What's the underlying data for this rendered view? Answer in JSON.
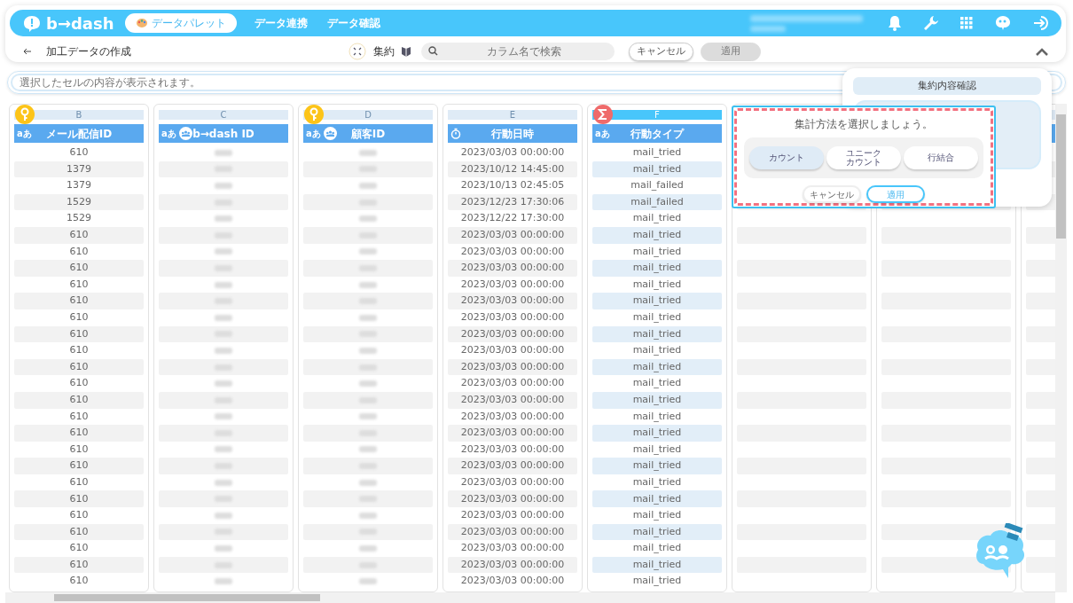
{
  "header": {
    "logo": "b→dash",
    "palette_button": "データパレット",
    "nav": [
      {
        "label": "データ連携"
      },
      {
        "label": "データ確認"
      }
    ]
  },
  "toolbar": {
    "title": "加工データの作成",
    "mode": "集約",
    "search": {
      "placeholder": "カラム名で検索"
    },
    "buttons": [
      {
        "label": "キャンセル",
        "disabled": false
      },
      {
        "label": "適用",
        "disabled": true
      }
    ]
  },
  "cell_viewer": {
    "placeholder": "選択したセルの内容が表示されます。"
  },
  "columns": [
    {
      "letter": "B",
      "name": "メール配信ID",
      "kind": "text",
      "type_label": "aあ",
      "key": true,
      "aggregated": false,
      "selected": false,
      "masked": false,
      "values": [
        "610",
        "1379",
        "1379",
        "1529",
        "1529",
        "610",
        "610",
        "610",
        "610",
        "610",
        "610",
        "610",
        "610",
        "610",
        "610",
        "610",
        "610",
        "610",
        "610",
        "610",
        "610",
        "610",
        "610",
        "610",
        "610",
        "610",
        "610"
      ]
    },
    {
      "letter": "C",
      "name": "b→dash ID",
      "kind": "user",
      "type_label": "aあ",
      "key": false,
      "aggregated": false,
      "selected": false,
      "masked": true
    },
    {
      "letter": "D",
      "name": "顧客ID",
      "kind": "user",
      "type_label": "aあ",
      "key": true,
      "aggregated": false,
      "selected": false,
      "masked": true
    },
    {
      "letter": "E",
      "name": "行動日時",
      "kind": "datetime",
      "key": false,
      "aggregated": false,
      "selected": false,
      "masked": false,
      "values": [
        "2023/03/03 00:00:00",
        "2023/10/12 14:45:00",
        "2023/10/13 02:45:05",
        "2023/12/23 17:30:06",
        "2023/12/22 17:30:00",
        "2023/03/03 00:00:00",
        "2023/03/03 00:00:00",
        "2023/03/03 00:00:00",
        "2023/03/03 00:00:00",
        "2023/03/03 00:00:00",
        "2023/03/03 00:00:00",
        "2023/03/03 00:00:00",
        "2023/03/03 00:00:00",
        "2023/03/03 00:00:00",
        "2023/03/03 00:00:00",
        "2023/03/03 00:00:00",
        "2023/03/03 00:00:00",
        "2023/03/03 00:00:00",
        "2023/03/03 00:00:00",
        "2023/03/03 00:00:00",
        "2023/03/03 00:00:00",
        "2023/03/03 00:00:00",
        "2023/03/03 00:00:00",
        "2023/03/03 00:00:00",
        "2023/03/03 00:00:00",
        "2023/03/03 00:00:00",
        "2023/03/03 00:00:00"
      ]
    },
    {
      "letter": "F",
      "name": "行動タイプ",
      "kind": "text",
      "type_label": "aあ",
      "key": false,
      "aggregated": true,
      "selected": true,
      "masked": false,
      "values": [
        "mail_tried",
        "mail_tried",
        "mail_failed",
        "mail_failed",
        "mail_tried",
        "mail_tried",
        "mail_tried",
        "mail_tried",
        "mail_tried",
        "mail_tried",
        "mail_tried",
        "mail_tried",
        "mail_tried",
        "mail_tried",
        "mail_tried",
        "mail_tried",
        "mail_tried",
        "mail_tried",
        "mail_tried",
        "mail_tried",
        "mail_tried",
        "mail_tried",
        "mail_tried",
        "mail_tried",
        "mail_tried",
        "mail_tried",
        "mail_tried"
      ]
    },
    {
      "kind": "blank"
    },
    {
      "kind": "blank"
    },
    {
      "kind": "blank"
    }
  ],
  "side_panel": {
    "title": "集約内容確認"
  },
  "popup": {
    "prompt": "集計方法を選択しましょう。",
    "options": [
      {
        "label": "カウント",
        "selected": true
      },
      {
        "label": "ユニークカウント",
        "selected": false
      },
      {
        "label": "行結合",
        "selected": false
      }
    ],
    "buttons": [
      {
        "label": "キャンセル",
        "kind": "secondary"
      },
      {
        "label": "適用",
        "kind": "primary"
      }
    ]
  }
}
